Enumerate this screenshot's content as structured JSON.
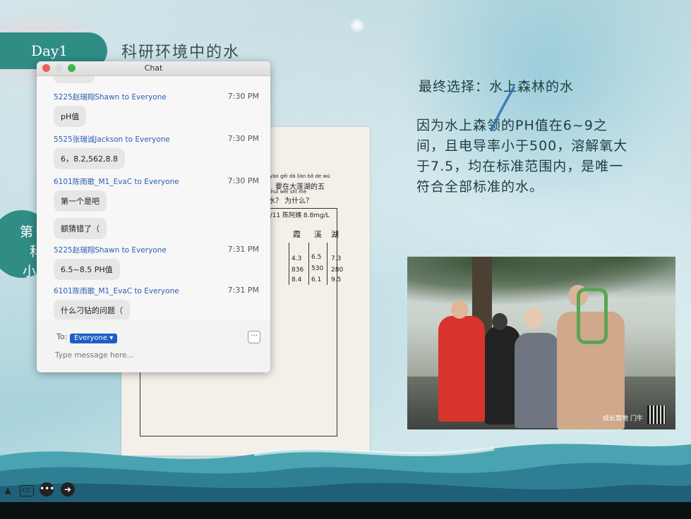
{
  "slide": {
    "day_label": "Day1",
    "title": "科研环境中的水",
    "final_choice": "最终选择：水上森林的水",
    "reason": "因为水上森领的PH值在6~9之间，且电导率小于500，溶解氧大于7.5，均在标准范围内，是唯一符合全部标准的水。",
    "left_circle_chars": [
      "第",
      "科",
      "小"
    ],
    "worksheet": {
      "header_lines": [
        "yào gěi dà liàn bǒ de wú",
        "，要在大莲湖的五",
        "shuǐ  wèi shí me",
        "水？ 为什么？"
      ],
      "note": "5/11 陈阿姨 8.8mg/L",
      "col_labels": [
        "霞",
        "溪",
        "湖"
      ],
      "rows": [
        [
          "4.3",
          "6.5",
          "7.3"
        ],
        [
          "836",
          "530",
          "280"
        ],
        [
          "8.4",
          "6.1",
          "9.5"
        ]
      ]
    },
    "photo_logo": "成长营地 门牛",
    "colors": {
      "teal": "#2f8d86",
      "text": "#1f3e40"
    }
  },
  "chat": {
    "window_title": "Chat",
    "messages": [
      {
        "sender": "5225赵瑞翔Shawn",
        "to": "to Everyone",
        "time": "7:30 PM",
        "bubbles": [
          "pH值"
        ]
      },
      {
        "sender": "5525张瑞诚Jackson",
        "to": "to Everyone",
        "time": "7:30 PM",
        "bubbles": [
          "6，8.2,562,8.8"
        ]
      },
      {
        "sender": "6101陈雨歌_M1_EvaC",
        "to": "to Everyone",
        "time": "7:30 PM",
        "bubbles": [
          "第一个是吧",
          "额猜错了（"
        ]
      },
      {
        "sender": "5225赵瑞翔Shawn",
        "to": "to Everyone",
        "time": "7:31 PM",
        "bubbles": [
          "6.5~8.5 PH值"
        ]
      },
      {
        "sender": "6101陈雨歌_M1_EvaC",
        "to": "to Everyone",
        "time": "7:31 PM",
        "bubbles": [
          "什么刁钻的问题（"
        ]
      }
    ],
    "to_label": "To:",
    "recipient": "Everyone",
    "more_label": "···",
    "input_placeholder": "Type message here..."
  },
  "toolbar": {
    "icons": [
      "triangle-icon",
      "closed-caption-icon",
      "more-icon",
      "arrow-right-icon"
    ],
    "cc_label": "CC"
  }
}
